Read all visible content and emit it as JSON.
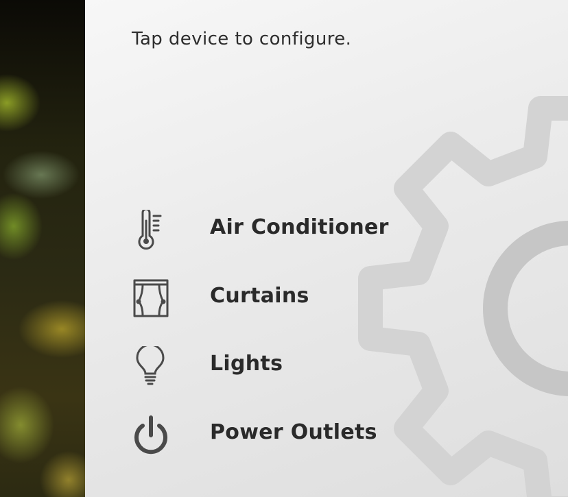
{
  "instruction": "Tap device to configure.",
  "devices": [
    {
      "label": "Air Conditioner",
      "icon": "thermometer-icon"
    },
    {
      "label": "Curtains",
      "icon": "curtains-icon"
    },
    {
      "label": "Lights",
      "icon": "lightbulb-icon"
    },
    {
      "label": "Power Outlets",
      "icon": "power-icon"
    }
  ],
  "colors": {
    "text": "#2a2a2a",
    "icon": "#4a4a4a",
    "panel_background": "#ececec",
    "gear_watermark": "#c8c8c8"
  },
  "background_gear_icon": "gear-icon"
}
